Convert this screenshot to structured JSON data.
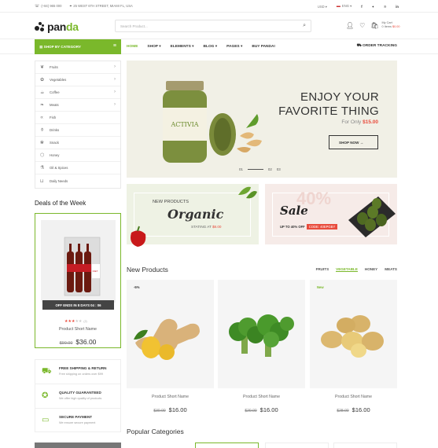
{
  "topbar": {
    "phone": "(+84) 965 000",
    "address": "25 WEST 6TH STREET, MIAMI FL, USA",
    "currency": "USD",
    "language": "ENG",
    "social": [
      "facebook-icon",
      "twitter-icon",
      "pinterest-icon",
      "linkedin-icon"
    ]
  },
  "header": {
    "logo_text_a": "pan",
    "logo_text_b": "da",
    "search_placeholder": "Search Product...",
    "cart_label": "My Cart",
    "cart_items": "0 Items",
    "cart_total": "$0.00"
  },
  "nav": {
    "shop_by_category": "SHOP BY CATEGORY",
    "links": [
      "HOME",
      "SHOP",
      "ELEMENTS",
      "BLOG",
      "PAGES",
      "BUY PANDA!"
    ],
    "order_tracking": "ORDER TRACKING"
  },
  "categories": [
    "Fruits",
    "Vegetables",
    "Coffee",
    "Meats",
    "Fish",
    "Drinks",
    "Snack",
    "Honey",
    "Oil & Spices",
    "Daily Needs"
  ],
  "deals": {
    "title": "Deals of the Week",
    "timer": "OFF ENDS IN  8 DAYS  04 : 06",
    "rating_count": "(2)",
    "name": "Product Short Name",
    "old_price": "$90.00",
    "price": "$36.00"
  },
  "features": [
    {
      "title": "FREE SHIPPING & RETURN",
      "sub": "Free shipping on orders over $99"
    },
    {
      "title": "QUALITY GUARANTEED",
      "sub": "We offer high quality of products"
    },
    {
      "title": "SECURE PAYMENT",
      "sub": "We ensure secure payment"
    }
  ],
  "hero": {
    "title_line1": "ENJOY YOUR",
    "title_line2": "FAVORITE THING",
    "sub": "For Only",
    "price": "$15.00",
    "button": "SHOP NOW",
    "jar_label": "ACTIVIA",
    "slide_current": "01",
    "slide_2": "02",
    "slide_3": "03"
  },
  "banner1": {
    "small": "NEW PRODUCTS",
    "big": "Organic",
    "sub": "STATING AT",
    "price": "$8.00"
  },
  "banner2": {
    "bg": "40%",
    "big": "Sale",
    "sub": "UP TO 40% OFF",
    "code": "CODE: 40EPGBY"
  },
  "new_products": {
    "title": "New Products",
    "tabs": [
      "FRUITS",
      "VEGETABLE",
      "HONEY",
      "MEATS"
    ],
    "items": [
      {
        "badge": "-5%",
        "name": "Product Short Name",
        "old": "$30.00",
        "price": "$16.00"
      },
      {
        "badge": "",
        "name": "Product Short Name",
        "old": "$20.00",
        "price": "$16.00"
      },
      {
        "badge": "New",
        "name": "Product Short Name",
        "old": "$28.00",
        "price": "$16.00"
      }
    ]
  },
  "popular": {
    "title": "Popular Categories"
  },
  "colors": {
    "accent": "#7ab82b",
    "sale": "#e94b3c"
  }
}
